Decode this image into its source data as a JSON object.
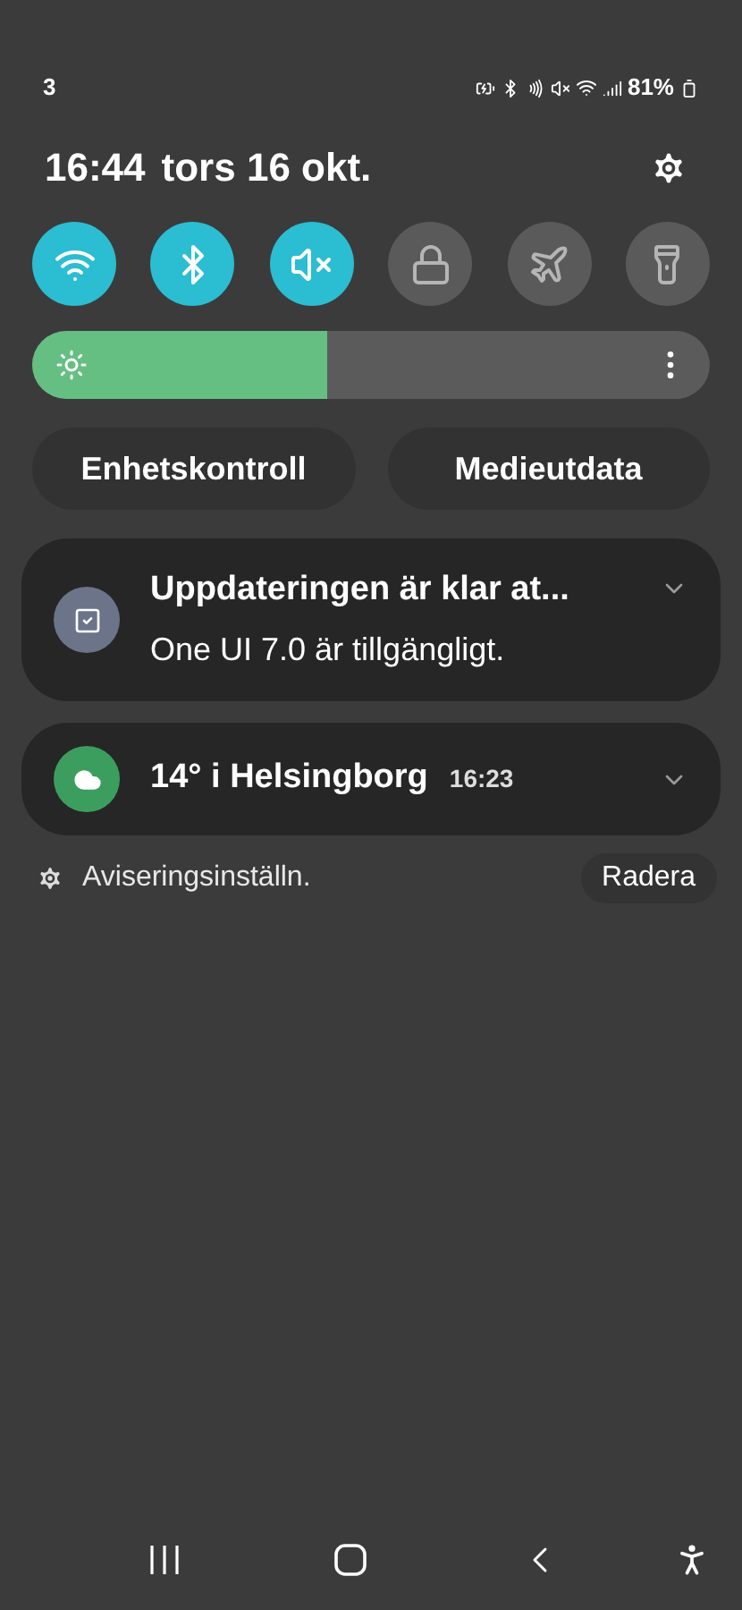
{
  "status_bar": {
    "carrier": "3",
    "battery": "81%"
  },
  "header": {
    "time": "16:44",
    "date": "tors 16 okt."
  },
  "quick_tiles": [
    {
      "kind": "wifi",
      "on": true
    },
    {
      "kind": "bluetooth",
      "on": true
    },
    {
      "kind": "sound",
      "on": true
    },
    {
      "kind": "lock",
      "on": false
    },
    {
      "kind": "airplane",
      "on": false
    },
    {
      "kind": "flashlight",
      "on": false
    }
  ],
  "brightness": {
    "level": 0.435
  },
  "buttons": [
    "Enhetskontroll",
    "Medieutdata"
  ],
  "notifications": [
    {
      "kind": "update",
      "title": "Uppdateringen är klar at...",
      "text": "One UI 7.0 är tillgängligt."
    },
    {
      "kind": "weather",
      "title": "14° i Helsingborg",
      "time": "16:23"
    }
  ],
  "footer": {
    "settings": "Aviseringsinställn.",
    "clear": "Radera"
  }
}
